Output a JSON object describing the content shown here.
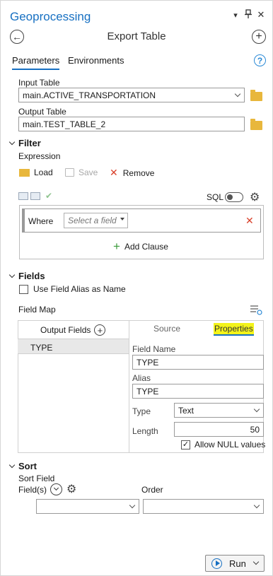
{
  "pane": {
    "title": "Geoprocessing",
    "menu_icon": "▾",
    "pin_icon": "⊣",
    "close_icon": "✕"
  },
  "tool": {
    "title": "Export Table",
    "back_icon": "←",
    "add_icon": "+"
  },
  "tabs": [
    {
      "label": "Parameters",
      "active": true
    },
    {
      "label": "Environments",
      "active": false
    }
  ],
  "help_icon": "?",
  "inputs": {
    "input_table_label": "Input Table",
    "input_table_value": "main.ACTIVE_TRANSPORTATION",
    "output_table_label": "Output Table",
    "output_table_value": "main.TEST_TABLE_2"
  },
  "filter": {
    "section_label": "Filter",
    "expression_label": "Expression",
    "load_label": "Load",
    "save_label": "Save",
    "remove_label": "Remove",
    "sql_label": "SQL",
    "where_label": "Where",
    "field_placeholder": "Select a field",
    "add_clause_label": "Add Clause"
  },
  "fields": {
    "section_label": "Fields",
    "alias_checkbox_label": "Use Field Alias as Name",
    "field_map_label": "Field Map",
    "output_fields_label": "Output Fields",
    "source_tab": "Source",
    "properties_tab": "Properties",
    "rows": [
      "TYPE"
    ],
    "props": {
      "field_name_label": "Field Name",
      "field_name_value": "TYPE",
      "alias_label": "Alias",
      "alias_value": "TYPE",
      "type_label": "Type",
      "type_value": "Text",
      "length_label": "Length",
      "length_value": "50",
      "allow_null_label": "Allow NULL values",
      "allow_null_checked": true
    }
  },
  "sort": {
    "section_label": "Sort",
    "sort_field_label": "Sort Field",
    "fields_label": "Field(s)",
    "order_label": "Order",
    "field_value": "",
    "order_value": ""
  },
  "run": {
    "label": "Run"
  },
  "colors": {
    "accent": "#1770c2",
    "highlight": "#f3f31a",
    "remove_red": "#d9412b",
    "add_green": "#3a9a3a",
    "folder": "#e8b73c"
  }
}
